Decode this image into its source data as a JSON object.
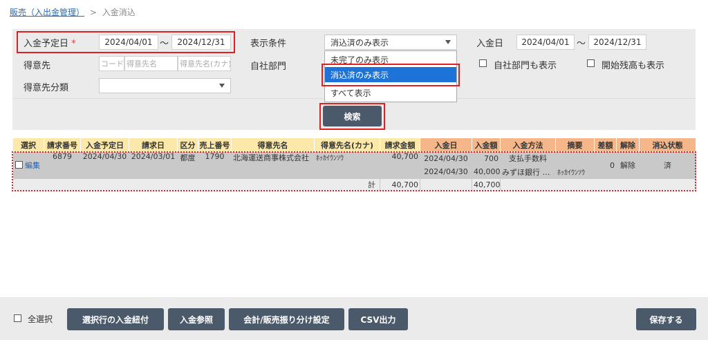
{
  "breadcrumb": {
    "parent": "販売（入出金管理）",
    "separator": ">",
    "current": "入金消込"
  },
  "filters": {
    "due_date": {
      "label": "入金予定日",
      "required_mark": "*",
      "from": "2024/04/01",
      "tilde": "〜",
      "to": "2024/12/31"
    },
    "customer": {
      "label": "得意先",
      "code_placeholder": "コード",
      "name_placeholder": "得意先名",
      "kana_placeholder": "得意先名(カナ)"
    },
    "customer_category": {
      "label": "得意先分類",
      "value": ""
    },
    "display": {
      "label": "表示条件",
      "value": "消込済のみ表示",
      "options": [
        "未完了のみ表示",
        "消込済のみ表示",
        "すべて表示"
      ],
      "selected_index": 1
    },
    "department": {
      "label": "自社部門"
    },
    "payment_date": {
      "label": "入金日",
      "from": "2024/04/01",
      "tilde": "〜",
      "to": "2024/12/31"
    },
    "show_department": {
      "label": "自社部門も表示",
      "checked": false
    },
    "show_opening": {
      "label": "開始残高も表示",
      "checked": false
    },
    "search_button": "検索"
  },
  "table": {
    "headers": [
      "選択",
      "請求番号",
      "入金予定日",
      "請求日",
      "区分",
      "売上番号",
      "得意先名",
      "得意先名(カナ)",
      "請求金額",
      "入金日",
      "入金額",
      "入金方法",
      "摘要",
      "差額",
      "解除",
      "消込状態"
    ],
    "row": {
      "edit": "編集",
      "invoice_no": "6879",
      "due_date": "2024/04/30",
      "invoice_date": "2024/03/01",
      "type": "都度",
      "sales_no": "1790",
      "customer": "北海運送商事株式会社",
      "customer_kana": "ﾎｯｶｲｳﾝｿｳ",
      "amount": "40,700",
      "payments": [
        {
          "date": "2024/04/30",
          "amount": "700",
          "method": "支払手数料",
          "memo": ""
        },
        {
          "date": "2024/04/30",
          "amount": "40,000",
          "method": "みずほ銀行 …",
          "memo": "ﾎｯｶｲｳﾝｿｳ"
        }
      ],
      "diff": "0",
      "release": "解除",
      "status": "済"
    },
    "total": {
      "label": "計",
      "amount": "40,700",
      "paid": "40,700"
    }
  },
  "footer": {
    "select_all": "全選択",
    "buttons": [
      "選択行の入金紐付",
      "入金参照",
      "会計/販売振り分け設定",
      "CSV出力"
    ],
    "save": "保存する"
  }
}
